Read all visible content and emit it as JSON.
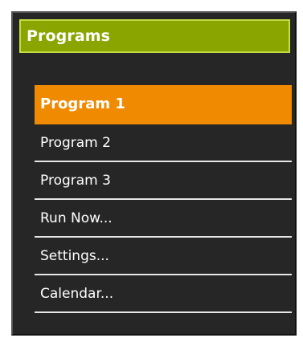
{
  "header": {
    "title": "Programs"
  },
  "menu": {
    "items": [
      {
        "label": "Program 1",
        "active": true
      },
      {
        "label": "Program 2",
        "active": false
      },
      {
        "label": "Program 3",
        "active": false
      },
      {
        "label": "Run Now...",
        "active": false
      },
      {
        "label": "Settings...",
        "active": false
      },
      {
        "label": "Calendar...",
        "active": false
      }
    ]
  },
  "colors": {
    "header_bg": "#8aa400",
    "header_border": "#c6dc43",
    "panel_bg": "#262626",
    "active_item_bg": "#f08a00",
    "separator": "#e6e6e6",
    "text": "#ffffff"
  }
}
